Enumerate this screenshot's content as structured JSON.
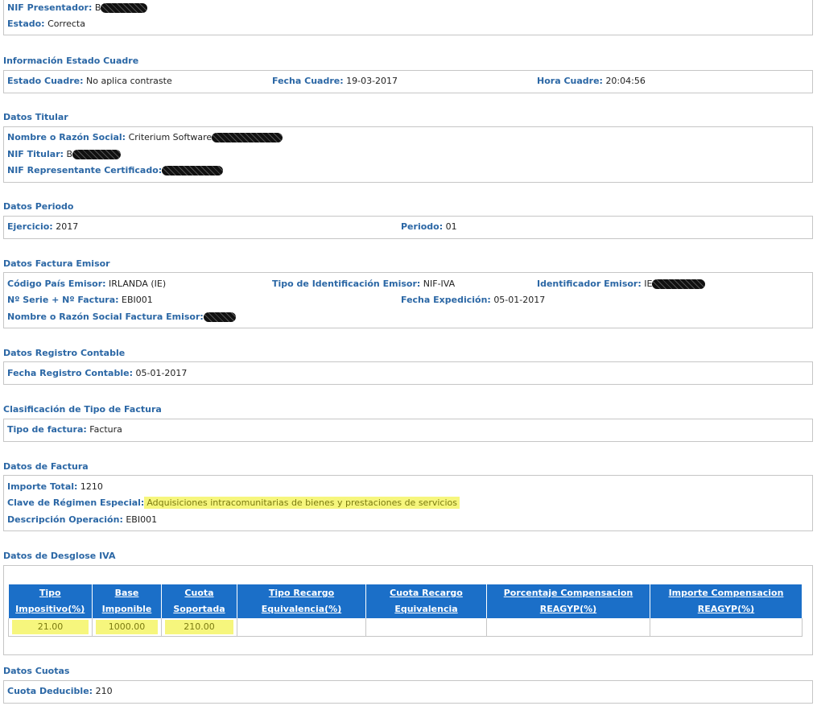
{
  "presentador": {
    "nif_label": "NIF Presentador:",
    "nif_value": "B",
    "estado_label": "Estado:",
    "estado_value": "Correcta"
  },
  "estado_cuadre": {
    "title": "Información Estado Cuadre",
    "estado_label": "Estado Cuadre:",
    "estado_value": "No aplica contraste",
    "fecha_label": "Fecha Cuadre:",
    "fecha_value": "19-03-2017",
    "hora_label": "Hora Cuadre:",
    "hora_value": "20:04:56"
  },
  "titular": {
    "title": "Datos Titular",
    "nombre_label": "Nombre o Razón Social:",
    "nombre_value": "Criterium Software",
    "nif_label": "NIF Titular:",
    "nif_value": "B",
    "representante_label": "NIF Representante Certificado:"
  },
  "periodo": {
    "title": "Datos Periodo",
    "ejercicio_label": "Ejercicio:",
    "ejercicio_value": "2017",
    "periodo_label": "Periodo:",
    "periodo_value": "01"
  },
  "factura_emisor": {
    "title": "Datos Factura Emisor",
    "pais_label": "Código País Emisor:",
    "pais_value": "IRLANDA (IE)",
    "tipo_id_label": "Tipo de Identificación Emisor:",
    "tipo_id_value": "NIF-IVA",
    "identificador_label": "Identificador Emisor:",
    "identificador_value": "IE",
    "serie_label": "Nº Serie + Nº Factura:",
    "serie_value": "EBI001",
    "expedicion_label": "Fecha Expedición:",
    "expedicion_value": "05-01-2017",
    "nombre_label": "Nombre o Razón Social Factura Emisor:"
  },
  "registro_contable": {
    "title": "Datos Registro Contable",
    "fecha_label": "Fecha Registro Contable:",
    "fecha_value": "05-01-2017"
  },
  "clasificacion": {
    "title": "Clasificación de Tipo de Factura",
    "tipo_label": "Tipo de factura:",
    "tipo_value": "Factura"
  },
  "datos_factura": {
    "title": "Datos de Factura",
    "importe_label": "Importe Total:",
    "importe_value": "1210",
    "clave_label": "Clave de Régimen Especial:",
    "clave_value": "Adquisiciones intracomunitarias de bienes y prestaciones de servicios",
    "descripcion_label": "Descripción Operación:",
    "descripcion_value": "EBI001"
  },
  "desglose_iva": {
    "title": "Datos de Desglose IVA",
    "headers": [
      [
        "Tipo",
        "Impositivo(%)"
      ],
      [
        "Base",
        "Imponible"
      ],
      [
        "Cuota",
        "Soportada"
      ],
      [
        "Tipo Recargo",
        "Equivalencia(%)"
      ],
      [
        "Cuota Recargo",
        "Equivalencia"
      ],
      [
        "Porcentaje Compensacion",
        "REAGYP(%)"
      ],
      [
        "Importe Compensacion",
        "REAGYP(%)"
      ]
    ],
    "row": [
      "21.00",
      "1000.00",
      "210.00",
      "",
      "",
      "",
      ""
    ]
  },
  "cuotas": {
    "title": "Datos Cuotas",
    "deducible_label": "Cuota Deducible:",
    "deducible_value": "210"
  },
  "colors": {
    "label": "#2b67a5",
    "header_bg": "#1b6fc8",
    "highlight": "#f6f67d"
  }
}
